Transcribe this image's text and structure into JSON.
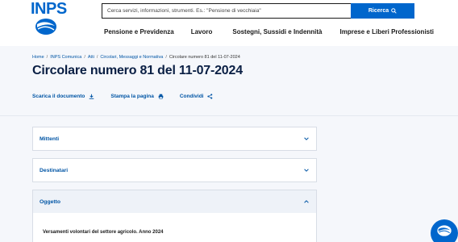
{
  "header": {
    "logo_text": "INPS",
    "search": {
      "placeholder": "Cerca servizi, informazioni, strumenti. Es.: \"Pensione di vecchiaia\"",
      "button_label": "Ricerca"
    },
    "nav": [
      {
        "label": "Pensione e Previdenza"
      },
      {
        "label": "Lavoro"
      },
      {
        "label": "Sostegni, Sussidi e Indennità"
      },
      {
        "label": "Imprese e Liberi Professionisti"
      }
    ]
  },
  "breadcrumb": {
    "items": [
      "Home",
      "INPS Comunica",
      "Atti",
      "Circolari, Messaggi e Normativa"
    ],
    "current": "Circolare numero 81 del 11-07-2024"
  },
  "page": {
    "title": "Circolare numero 81 del 11-07-2024"
  },
  "actions": {
    "download": "Scarica il documento",
    "print": "Stampa la pagina",
    "share": "Condividi"
  },
  "accordion": [
    {
      "label": "Mittenti",
      "expanded": false
    },
    {
      "label": "Destinatari",
      "expanded": false
    },
    {
      "label": "Oggetto",
      "expanded": true,
      "body": "Versamenti volontari del settore agricolo. Anno 2024"
    }
  ],
  "colors": {
    "brand_blue": "#0066cc",
    "link_blue": "#0055a5",
    "title_navy": "#0a1f44"
  },
  "icons": [
    "search-icon",
    "download-icon",
    "print-icon",
    "share-icon",
    "chevron-down-icon",
    "chevron-up-icon",
    "inps-logo-mark"
  ]
}
